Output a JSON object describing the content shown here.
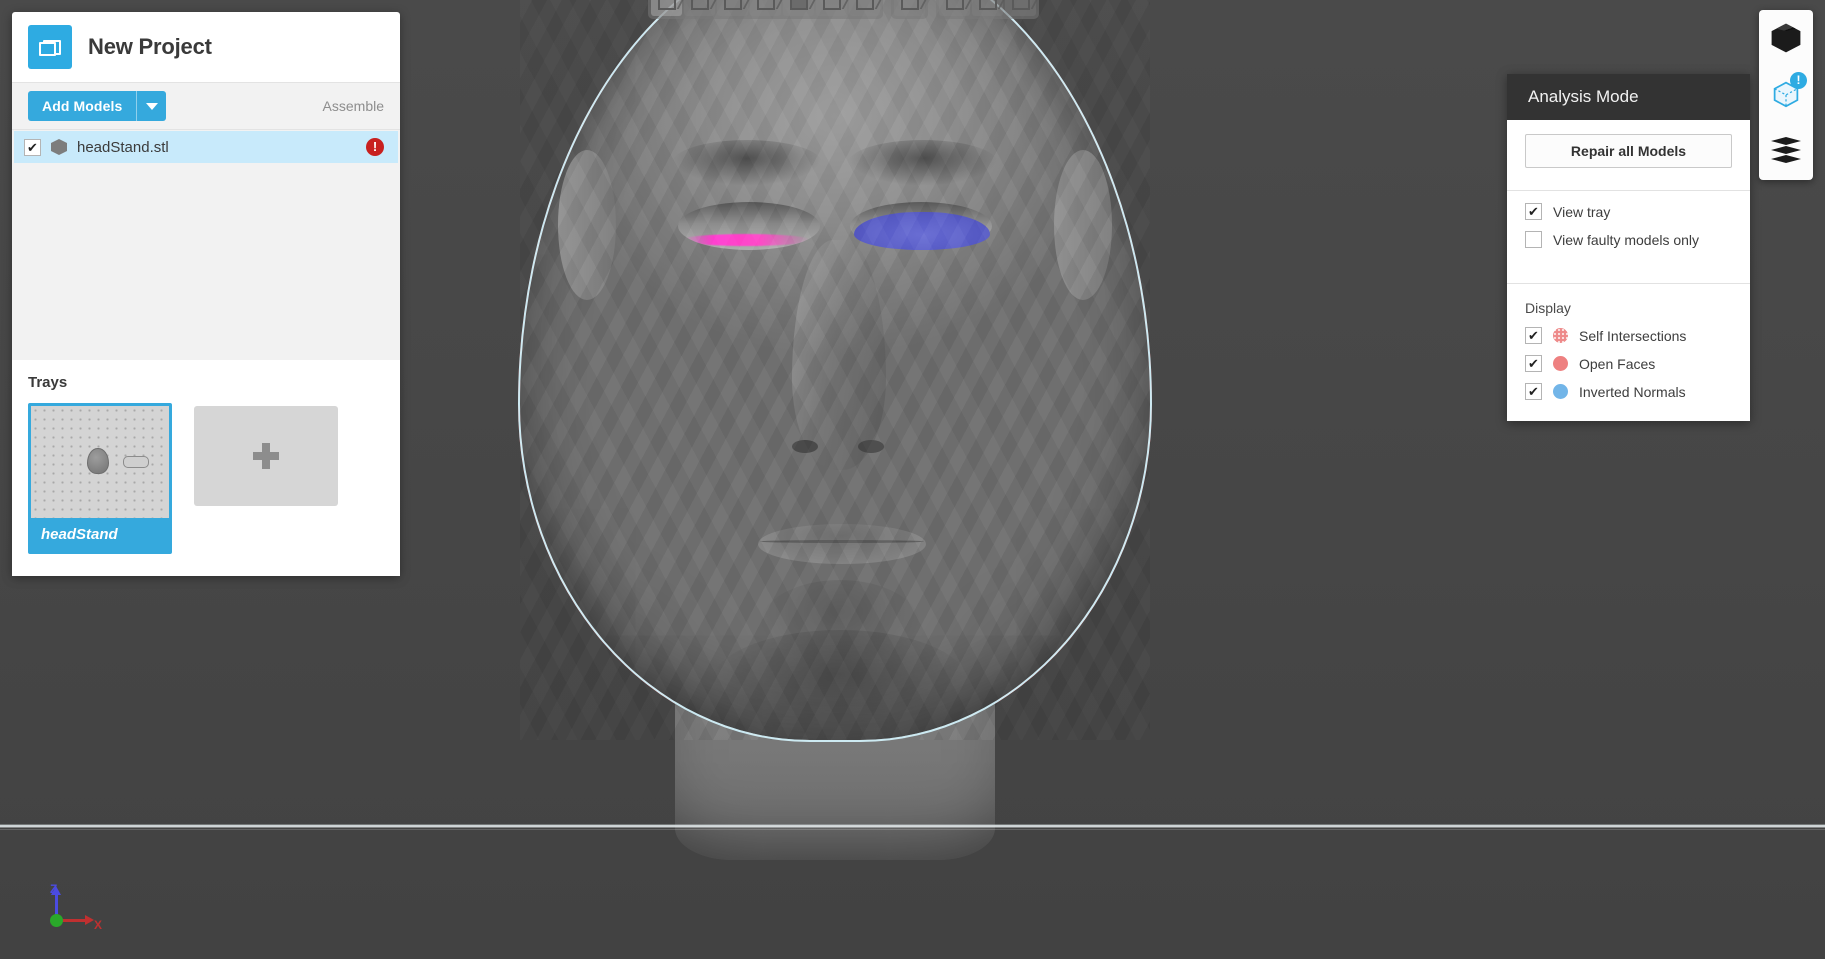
{
  "app": {
    "viewport_background": "#454545",
    "accent": "#35a9dd",
    "error_color": "#c8201f"
  },
  "top_toolbar": {
    "groups": [
      {
        "buttons": [
          {
            "name": "view-front-icon",
            "label": "Front view"
          },
          {
            "name": "view-back-icon",
            "label": "Back view"
          },
          {
            "name": "view-left-icon",
            "label": "Left view"
          },
          {
            "name": "view-right-icon",
            "label": "Right view"
          },
          {
            "name": "view-top-icon",
            "label": "Top view"
          },
          {
            "name": "view-bottom-icon",
            "label": "Bottom view"
          },
          {
            "name": "view-iso-icon",
            "label": "Isometric view"
          }
        ]
      },
      {
        "buttons": [
          {
            "name": "view-fit-icon",
            "label": "Fit to view"
          }
        ]
      },
      {
        "buttons": [
          {
            "name": "tool-rotate-icon",
            "label": "Rotate"
          },
          {
            "name": "tool-mirror-icon",
            "label": "Mirror"
          },
          {
            "name": "tool-lay-flat-icon",
            "label": "Lay flat"
          }
        ]
      }
    ]
  },
  "left_panel": {
    "project_title": "New Project",
    "folder_icon": "folder-icon",
    "models_toolbar": {
      "add_models_label": "Add Models",
      "add_models_caret": "chevron-down-icon",
      "assemble_label": "Assemble"
    },
    "models": [
      {
        "checked": true,
        "check_glyph": "✔",
        "icon": "model-cube-icon",
        "name": "headStand.stl",
        "badge": "!",
        "badge_name": "error-badge"
      }
    ],
    "trays": {
      "title": "Trays",
      "items": [
        {
          "label": "headStand",
          "selected": true
        }
      ],
      "add_tray_glyph": "+"
    }
  },
  "analysis_panel": {
    "title": "Analysis Mode",
    "repair_button_label": "Repair all Models",
    "options": [
      {
        "label": "View tray",
        "checked": true,
        "check_glyph": "✔"
      },
      {
        "label": "View faulty models only",
        "checked": false,
        "check_glyph": ""
      }
    ],
    "display_section_title": "Display",
    "display_items": [
      {
        "label": "Self Intersections",
        "checked": true,
        "check_glyph": "✔",
        "color": "#ee8a8a",
        "pattern": "dotted"
      },
      {
        "label": "Open Faces",
        "checked": true,
        "check_glyph": "✔",
        "color": "#ee8080",
        "pattern": "solid"
      },
      {
        "label": "Inverted Normals",
        "checked": true,
        "check_glyph": "✔",
        "color": "#72b5e8",
        "pattern": "solid"
      }
    ]
  },
  "mode_toolbar": {
    "buttons": [
      {
        "name": "prepare-mode-icon",
        "label": "Prepare",
        "active": false,
        "badge": ""
      },
      {
        "name": "analysis-mode-icon",
        "label": "Analysis",
        "active": true,
        "badge": "!"
      },
      {
        "name": "preview-mode-icon",
        "label": "Preview",
        "active": false,
        "badge": ""
      }
    ]
  },
  "axis_gizmo": {
    "z_label": "Z",
    "x_label": "X",
    "z_color": "#4b4be0",
    "x_color": "#c03030",
    "origin_color": "#2aa82a"
  },
  "model_view": {
    "model_name": "headStand.stl",
    "defect_overlays": [
      {
        "type": "Open Faces",
        "color": "#e02a2a",
        "location": "silhouette outline"
      },
      {
        "type": "Self Intersections",
        "color": "#ff3fd0",
        "location": "left eye lower lid"
      },
      {
        "type": "Inverted Normals",
        "color": "#5b5fc7",
        "location": "right eye"
      }
    ]
  }
}
